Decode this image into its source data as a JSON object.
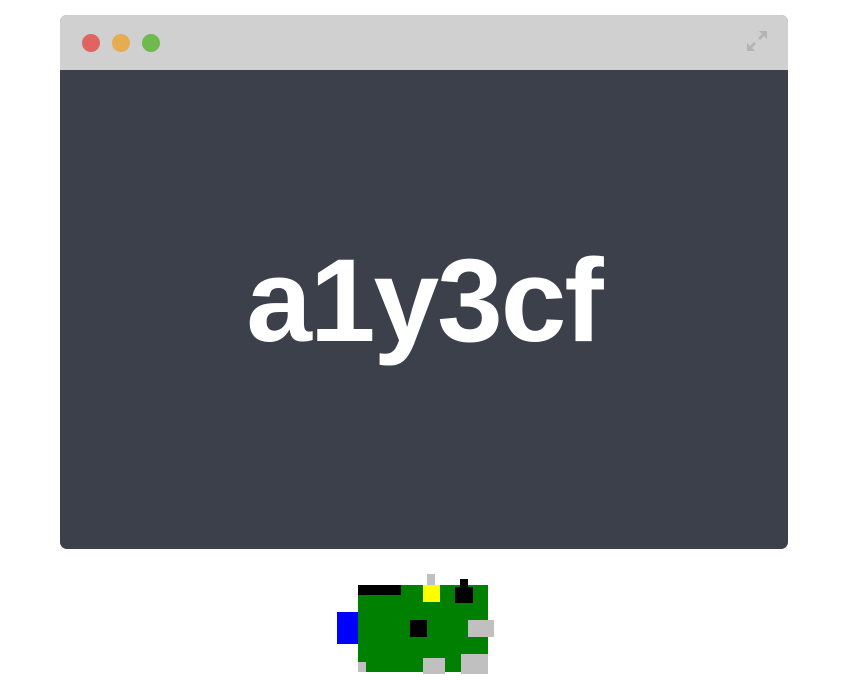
{
  "window": {
    "controls": [
      "close",
      "minimize",
      "zoom"
    ],
    "expand_icon": "expand-arrows-icon",
    "content_text": "a1y3cf"
  },
  "colors": {
    "titlebar": "#d0d0d0",
    "content_bg": "#3b404a",
    "close": "#e06561",
    "minimize": "#e6ac50",
    "zoom": "#6fba4f",
    "text": "#ffffff"
  },
  "mascot": {
    "icon": "raspberry-pi-board-icon"
  }
}
